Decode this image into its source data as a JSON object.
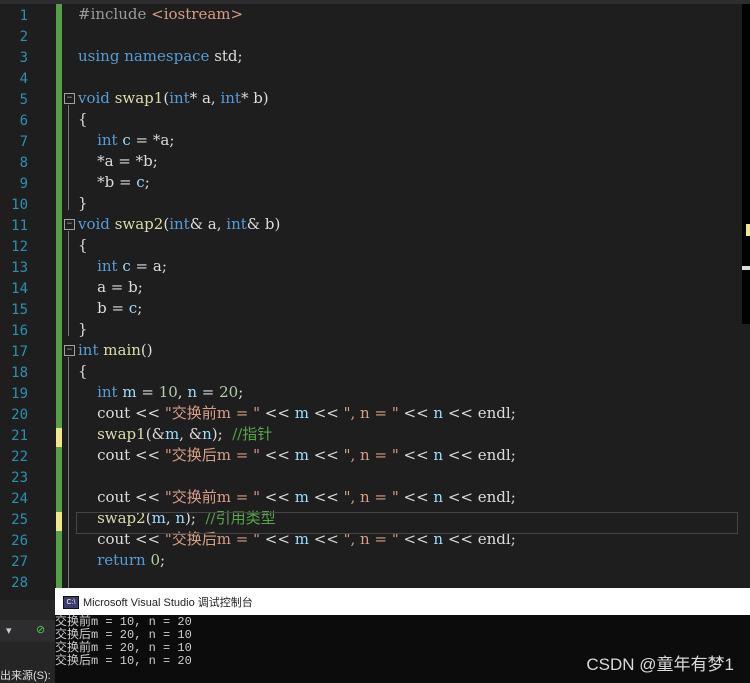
{
  "editor": {
    "lines": [
      "#include <iostream>",
      "",
      "using namespace std;",
      "",
      "void swap1(int* a, int* b)",
      "{",
      "    int c = *a;",
      "    *a = *b;",
      "    *b = c;",
      "}",
      "void swap2(int& a, int& b)",
      "{",
      "    int c = a;",
      "    a = b;",
      "    b = c;",
      "}",
      "int main()",
      "{",
      "    int m = 10, n = 20;",
      "    cout << \"交换前m = \" << m << \", n = \" << n << endl;",
      "    swap1(&m, &n);  //指针",
      "    cout << \"交换后m = \" << m << \", n = \" << n << endl;",
      "",
      "    cout << \"交换前m = \" << m << \", n = \" << n << endl;",
      "    swap2(m, n);  //引用类型",
      "    cout << \"交换后m = \" << m << \", n = \" << n << endl;",
      "    return 0;",
      ""
    ],
    "line_numbers": [
      "1",
      "2",
      "3",
      "4",
      "5",
      "6",
      "7",
      "8",
      "9",
      "10",
      "11",
      "12",
      "13",
      "14",
      "15",
      "16",
      "17",
      "18",
      "19",
      "20",
      "21",
      "22",
      "23",
      "24",
      "25",
      "26",
      "27",
      "28"
    ]
  },
  "console": {
    "title": "Microsoft Visual Studio 调试控制台",
    "icon": "C:\\",
    "output": [
      "交换前m = 10, n = 20",
      "交换后m = 20, n = 10",
      "交换前m = 20, n = 10",
      "交换后m = 10, n = 20"
    ]
  },
  "left_panel": {
    "bottom_label": "出来源(S):"
  },
  "watermark": "CSDN @童年有梦1",
  "colors": {
    "keyword": "#569cd6",
    "string": "#d69d85",
    "comment": "#57a64a",
    "line_number": "#2b91af",
    "change_bar": "#57a64a"
  }
}
